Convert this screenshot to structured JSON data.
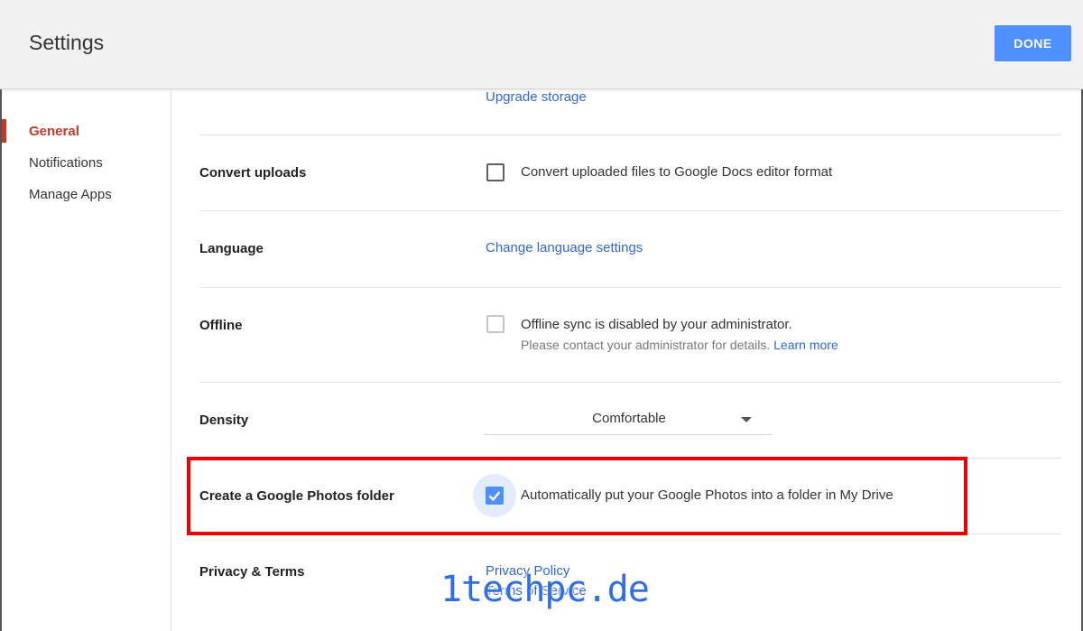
{
  "header": {
    "title": "Settings",
    "done_label": "DONE"
  },
  "sidebar": {
    "items": [
      {
        "label": "General",
        "active": true
      },
      {
        "label": "Notifications",
        "active": false
      },
      {
        "label": "Manage Apps",
        "active": false
      }
    ]
  },
  "storage": {
    "upgrade_link": "Upgrade storage"
  },
  "convert_uploads": {
    "label": "Convert uploads",
    "checkbox_text": "Convert uploaded files to Google Docs editor format",
    "checked": false
  },
  "language": {
    "label": "Language",
    "link": "Change language settings"
  },
  "offline": {
    "label": "Offline",
    "checkbox_text": "Offline sync is disabled by your administrator.",
    "sub_text": "Please contact your administrator for details.",
    "learn_more": "Learn more",
    "checked": false,
    "disabled": true
  },
  "density": {
    "label": "Density",
    "value": "Comfortable"
  },
  "photos_folder": {
    "label": "Create a Google Photos folder",
    "checkbox_text": "Automatically put your Google Photos into a folder in My Drive",
    "checked": true
  },
  "privacy": {
    "label": "Privacy & Terms",
    "privacy_link": "Privacy Policy",
    "terms_link": "Terms of Service"
  },
  "watermark": "1techpc.de",
  "colors": {
    "accent": "#4d90fe",
    "active_nav": "#c53929",
    "link": "#3367d6",
    "highlight_border": "#ee0000"
  }
}
